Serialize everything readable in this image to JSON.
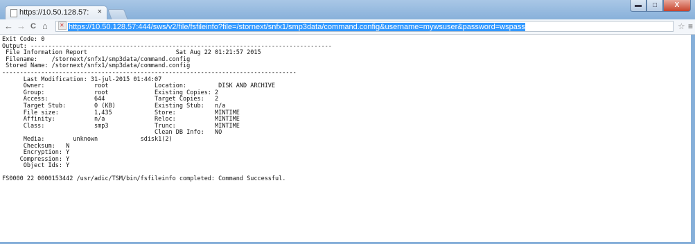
{
  "browser": {
    "tab_title": "https://10.50.128.57:",
    "tab_close": "×",
    "url": "https://10.50.128.57:444/sws/v2/file/fsfileinfo?file=/stornext/snfx1/smp3data/command.config&username=mywsuser&password=wspass",
    "back_icon": "←",
    "forward_icon": "→",
    "reload_icon": "C",
    "home_icon": "⌂",
    "star_icon": "☆",
    "menu_icon": "≡",
    "min_icon": "▬",
    "max_icon": "□",
    "close_icon": "X"
  },
  "report": {
    "lines": [
      "Exit Code: 0",
      "Output: -------------------------------------------------------------------------------------",
      " File Information Report                         Sat Aug 22 01:21:57 2015",
      " Filename:    /stornext/snfx1/smp3data/command.config",
      " Stored Name: /stornext/snfx1/smp3data/command.config",
      "-----------------------------------------------------------------------------------",
      "      Last Modification: 31-jul-2015 01:44:07",
      "      Owner:              root             Location:         DISK AND ARCHIVE",
      "      Group:              root             Existing Copies: 2",
      "      Access:             644              Target Copies:   2",
      "      Target Stub:        0 (KB)           Existing Stub:   n/a",
      "      File size:          1,435            Store:           MINTIME",
      "      Affinity:           n/a              Reloc:           MINTIME",
      "      Class:              smp3             Trunc:           MINTIME",
      "                                           Clean DB Info:   NO",
      "      Media:        unknown            sdisk1(2)",
      "      Checksum:   N",
      "      Encryption: Y",
      "     Compression: Y",
      "      Object Ids: Y",
      "",
      "FS0000 22 0000153442 /usr/adic/TSM/bin/fsfileinfo completed: Command Successful."
    ]
  }
}
